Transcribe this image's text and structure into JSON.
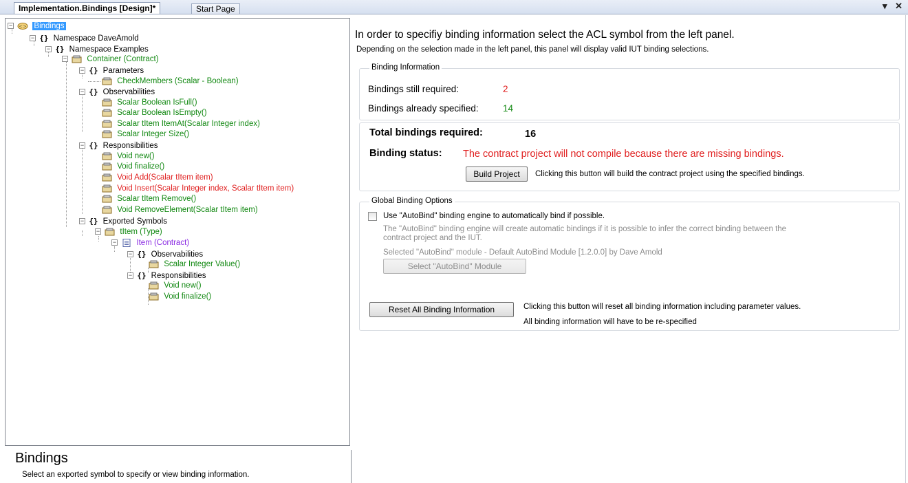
{
  "tabs": {
    "active": "Implementation.Bindings [Design]*",
    "inactive": "Start Page",
    "dropdown_glyph": "▾",
    "close_glyph": "✕"
  },
  "tree": {
    "root": "Bindings",
    "ns_glyph": "{}",
    "expanded_glyph": "−",
    "nodes": [
      {
        "label": "Namespace DaveAmold"
      },
      {
        "label": "Namespace Examples"
      },
      {
        "label": "Container (Contract)"
      },
      {
        "label": "Parameters"
      },
      {
        "label": "CheckMembers (Scalar - Boolean)"
      },
      {
        "label": "Observabilities"
      },
      {
        "label": "Scalar Boolean IsFull()"
      },
      {
        "label": "Scalar Boolean IsEmpty()"
      },
      {
        "label": "Scalar tItem ItemAt(Scalar Integer index)"
      },
      {
        "label": "Scalar Integer Size()"
      },
      {
        "label": "Responsibilities"
      },
      {
        "label": "Void new()"
      },
      {
        "label": "Void finalize()"
      },
      {
        "label": "Void Add(Scalar tItem item)"
      },
      {
        "label": "Void Insert(Scalar Integer index, Scalar tItem item)"
      },
      {
        "label": "Scalar tItem Remove()"
      },
      {
        "label": "Void RemoveElement(Scalar tItem item)"
      },
      {
        "label": "Exported Symbols"
      },
      {
        "label": "tItem (Type)"
      },
      {
        "label": "Item (Contract)"
      },
      {
        "label": "Observabilities"
      },
      {
        "label": "Scalar Integer Value()"
      },
      {
        "label": "Responsibilities"
      },
      {
        "label": "Void new()"
      },
      {
        "label": "Void finalize()"
      }
    ]
  },
  "description": {
    "title": "Bindings",
    "text": "Select an exported symbol to specify or view binding information."
  },
  "right": {
    "header": "In order to specifiy binding information select the ACL symbol from the left panel.",
    "subheader": "Depending on the selection made in the left panel, this panel will display valid IUT binding selections.",
    "binding_info": {
      "group_label": "Binding Information",
      "still_required_label": "Bindings still required:",
      "still_required_value": "2",
      "already_specified_label": "Bindings already specified:",
      "already_specified_value": "14"
    },
    "totals": {
      "total_label": "Total bindings required:",
      "total_value": "16",
      "status_label": "Binding status:",
      "status_value": "The contract project will not compile because there are missing bindings.",
      "build_button": "Build Project",
      "build_note": "Clicking this button will build the contract project using the specified bindings."
    },
    "global": {
      "group_label": "Global Binding Options",
      "autobind_checkbox_label": "Use \"AutoBind\" binding engine to automatically bind if possible.",
      "autobind_desc_line1": "The \"AutoBind\" binding engine will create automatic bindings if it is possible to infer the correct binding between the",
      "autobind_desc_line2": "contract project and the IUT.",
      "module_text": "Selected \"AutoBind\" module - Default AutoBind Module [1.2.0.0] by Dave Amold",
      "select_module_button": "Select \"AutoBind\" Module",
      "reset_button": "Reset All Binding Information",
      "reset_note1": "Clicking this button will reset all binding information including parameter values.",
      "reset_note2": "All binding information will have to be re-specified"
    }
  },
  "colors": {
    "green": "#118811",
    "red": "#e02020",
    "purple": "#8a2be2",
    "selection": "#3399ff"
  }
}
